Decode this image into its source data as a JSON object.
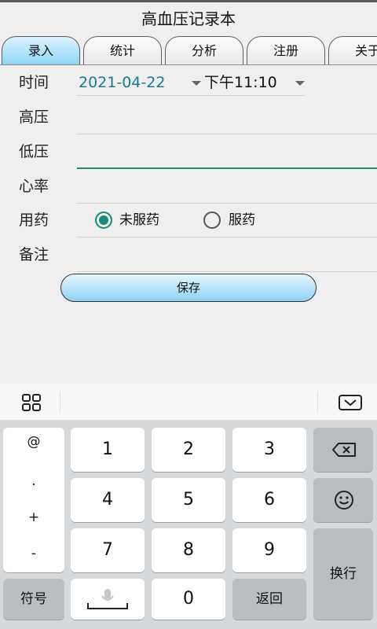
{
  "app": {
    "title": "高血压记录本"
  },
  "tabs": [
    {
      "label": "录入",
      "active": true
    },
    {
      "label": "统计",
      "active": false
    },
    {
      "label": "分析",
      "active": false
    },
    {
      "label": "注册",
      "active": false
    },
    {
      "label": "关于",
      "active": false
    }
  ],
  "form": {
    "time_label": "时间",
    "date_value": "2021-04-22",
    "time_value": "下午11:10",
    "systolic_label": "高压",
    "diastolic_label": "低压",
    "heart_rate_label": "心率",
    "medication_label": "用药",
    "med_option_none": "未服药",
    "med_option_taken": "服药",
    "medication_selected": "未服药",
    "note_label": "备注",
    "save_label": "保存"
  },
  "keyboard": {
    "symbols": [
      "@",
      ".",
      "+",
      "-"
    ],
    "digits": [
      "1",
      "2",
      "3",
      "4",
      "5",
      "6",
      "7",
      "8",
      "9",
      "0"
    ],
    "symbol_key": "符号",
    "return_key": "返回",
    "newline_key": "换行"
  },
  "colors": {
    "accent": "#1b8a78",
    "tab_active": "#8ed5f7",
    "date_text": "#147e8c"
  }
}
